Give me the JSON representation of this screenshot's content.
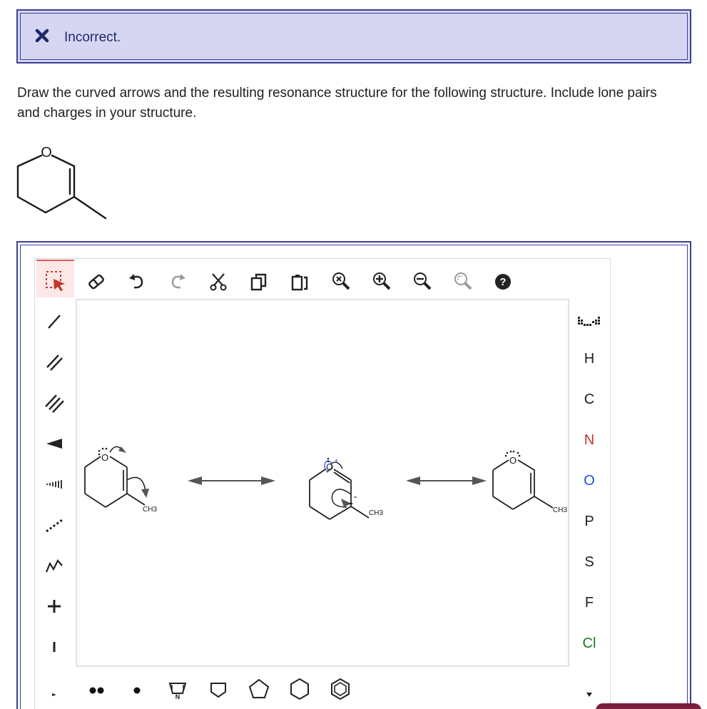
{
  "feedback": {
    "status_icon": "x-mark-icon",
    "status_text": "Incorrect.",
    "accent_color": "#1d2a6b",
    "background_color": "#d6d6f2"
  },
  "question": {
    "text": "Draw the curved arrows and the resulting resonance structure for the following structure. Include lone pairs and charges in your structure."
  },
  "given_structure": {
    "ring_atom": "O"
  },
  "toolbar": {
    "top_tools": [
      "select-lasso-icon",
      "eraser-icon",
      "undo-icon",
      "redo-icon",
      "cut-icon",
      "copy-icon",
      "paste-icon",
      "zoom-fit-icon",
      "zoom-in-icon",
      "zoom-out-icon",
      "zoom-selection-icon",
      "help-icon"
    ],
    "left_tools": [
      "single-bond-icon",
      "double-bond-icon",
      "triple-bond-icon",
      "wedge-bond-icon",
      "hash-bond-icon",
      "dashed-bond-icon",
      "chain-icon",
      "positive-charge-icon",
      "negative-charge-icon",
      "more-bonds-icon"
    ],
    "bottom_tools": [
      "lone-pair-icon",
      "radical-icon",
      "pyrrole-template-icon",
      "cyclobutane-icon",
      "cyclopentane-icon",
      "cyclohexane-icon",
      "benzene-icon"
    ]
  },
  "periodic_table_icon": "periodic-table-icon",
  "elements": [
    {
      "symbol": "H",
      "color": "#333333"
    },
    {
      "symbol": "C",
      "color": "#333333"
    },
    {
      "symbol": "N",
      "color": "#c0392b"
    },
    {
      "symbol": "O",
      "color": "#1f4fd6"
    },
    {
      "symbol": "P",
      "color": "#333333"
    },
    {
      "symbol": "S",
      "color": "#333333"
    },
    {
      "symbol": "F",
      "color": "#333333"
    },
    {
      "symbol": "Cl",
      "color": "#1e7a1e"
    }
  ],
  "canvas": {
    "structure_1": {
      "o_label": "O",
      "methyl_label": "CH3"
    },
    "structure_2": {
      "o_label": "O",
      "charge": "+",
      "methyl_label": "CH3"
    },
    "structure_3": {
      "o_label": "O",
      "methyl_label": "CH3"
    }
  }
}
